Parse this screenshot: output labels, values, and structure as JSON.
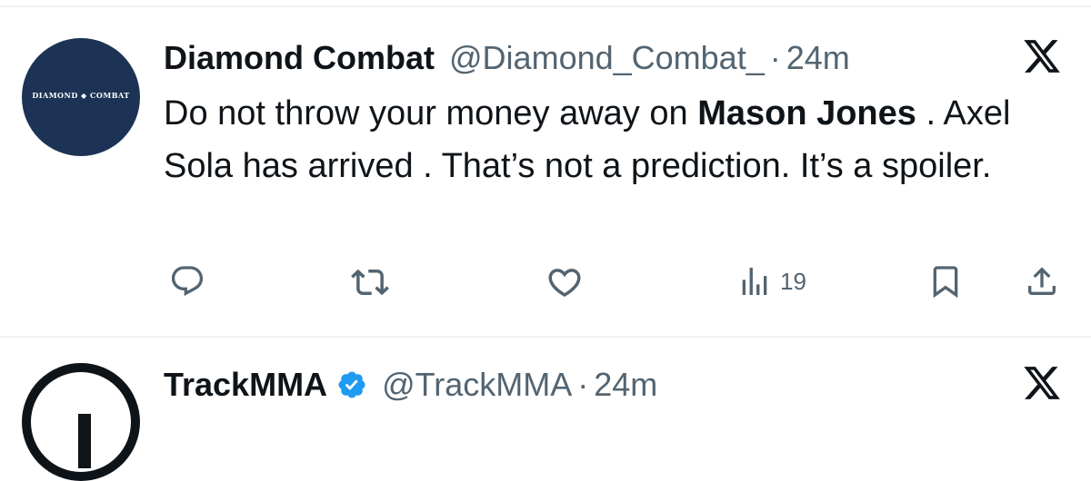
{
  "tweets": [
    {
      "avatar": {
        "text": "DIAMOND ◆ COMBAT",
        "bg_color": "#1c3355"
      },
      "display_name": "Diamond Combat",
      "handle": "@Diamond_Combat_",
      "separator": "·",
      "time": "24m",
      "verified": false,
      "text_part1": "Do not throw your money away on ",
      "text_mention": "Mason Jones",
      "text_part2": " . Axel Sola has arrived . That’s not a prediction. It’s a spoiler.",
      "actions": {
        "reply_icon": "reply-icon",
        "retweet_icon": "retweet-icon",
        "like_icon": "heart-icon",
        "views_icon": "views-icon",
        "views_count": "19",
        "bookmark_icon": "bookmark-icon",
        "share_icon": "share-icon"
      }
    },
    {
      "display_name": "TrackMMA",
      "handle": "@TrackMMA",
      "separator": "·",
      "time": "24m",
      "verified": true,
      "verified_color": "#1d9bf0"
    }
  ],
  "colors": {
    "text": "#0f1419",
    "secondary": "#536471",
    "divider": "#eff3f4"
  }
}
